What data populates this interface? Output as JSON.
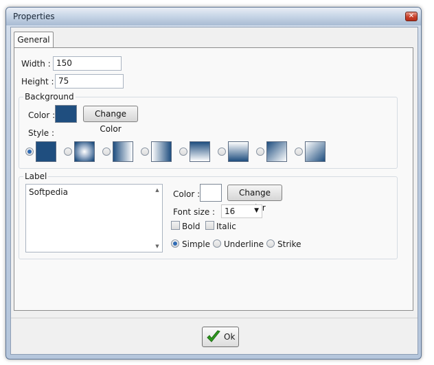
{
  "window": {
    "title": "Properties",
    "close_glyph": "✕"
  },
  "tabs": [
    {
      "label": "General"
    }
  ],
  "general": {
    "width_label": "Width :",
    "width_value": "150",
    "height_label": "Height :",
    "height_value": "75"
  },
  "background": {
    "legend": "Background",
    "color_label": "Color :",
    "color_value": "#1f4e7f",
    "change_color_label": "Change Color",
    "style_label": "Style :",
    "styles": [
      {
        "name": "solid",
        "selected": true
      },
      {
        "name": "radial",
        "selected": false
      },
      {
        "name": "horizontal-light-to-dark",
        "selected": false
      },
      {
        "name": "horizontal-dark-to-light",
        "selected": false
      },
      {
        "name": "vertical-dark-to-light",
        "selected": false
      },
      {
        "name": "vertical-light-to-dark",
        "selected": false
      },
      {
        "name": "diagonal-dark-to-light",
        "selected": false
      },
      {
        "name": "diagonal-light-to-dark",
        "selected": false
      }
    ]
  },
  "label": {
    "legend": "Label",
    "text": "Softpedia",
    "color_label": "Color :",
    "color_value": "#ffffff",
    "change_color_label": "Change Color",
    "font_size_label": "Font size :",
    "font_size_value": "16",
    "bold_label": "Bold",
    "bold_checked": false,
    "italic_label": "Italic",
    "italic_checked": false,
    "decorations": [
      {
        "label": "Simple",
        "selected": true
      },
      {
        "label": "Underline",
        "selected": false
      },
      {
        "label": "Strike",
        "selected": false
      }
    ]
  },
  "footer": {
    "ok_label": "Ok"
  }
}
